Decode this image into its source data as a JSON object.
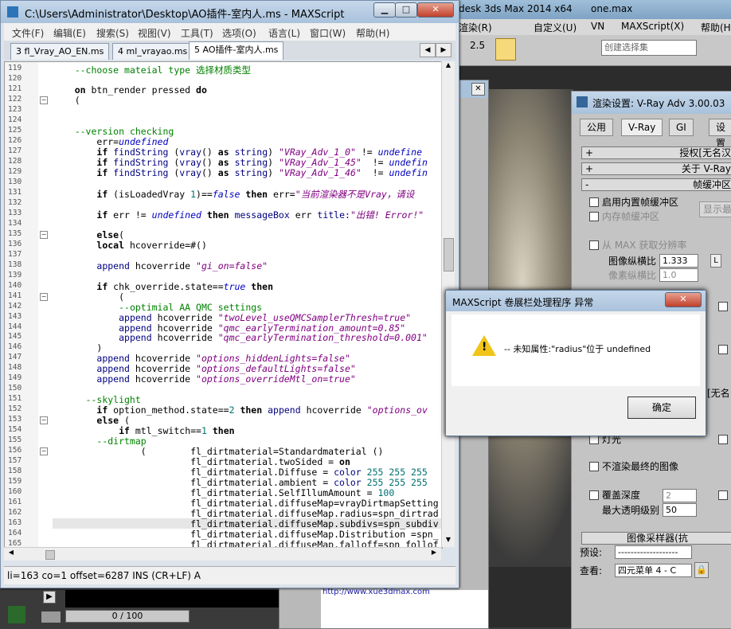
{
  "max": {
    "title": "desk 3ds Max  2014 x64",
    "file": "one.max",
    "menu": [
      "渲染(R)",
      "自定义(U)",
      "VN",
      "MAXScript(X)",
      "帮助(H"
    ],
    "toolbar": {
      "number": "2.5",
      "selection_set_placeholder": "创建选择集"
    }
  },
  "editor": {
    "title": "C:\\Users\\Administrator\\Desktop\\AO插件-室内人.ms - MAXScript",
    "menu": [
      "文件(F)",
      "编辑(E)",
      "搜索(S)",
      "视图(V)",
      "工具(T)",
      "选项(O)",
      "语言(L)",
      "窗口(W)",
      "帮助(H)"
    ],
    "tabs": [
      {
        "label": "3 fl_Vray_AO_EN.ms",
        "active": false
      },
      {
        "label": "4 ml_vrayao.ms",
        "active": false
      },
      {
        "label": "5 AO插件-室内人.ms",
        "active": true
      }
    ],
    "status": "li=163 co=1 offset=6287 INS (CR+LF) A",
    "lines": [
      {
        "n": "119",
        "html": "    <span class='cm'>--choose mateial type 选择材质类型</span>"
      },
      {
        "n": "120",
        "html": ""
      },
      {
        "n": "121",
        "html": "    <span class='kw'>on</span> btn_render pressed <span class='kw'>do</span>"
      },
      {
        "n": "122",
        "html": "    ("
      },
      {
        "n": "123",
        "html": ""
      },
      {
        "n": "124",
        "html": ""
      },
      {
        "n": "125",
        "html": "    <span class='cm'>--version checking</span>"
      },
      {
        "n": "126",
        "html": "        err=<span class='uv'>undefined</span>"
      },
      {
        "n": "127",
        "html": "        <span class='kw'>if</span> <span class='fn'>findString</span> (<span class='fn'>vray</span>() <span class='kw'>as</span> <span class='fn'>string</span>) <span class='st'>\"VRay_Adv_1_0\"</span> != <span class='uv'>undefine</span>"
      },
      {
        "n": "128",
        "html": "        <span class='kw'>if</span> <span class='fn'>findString</span> (<span class='fn'>vray</span>() <span class='kw'>as</span> <span class='fn'>string</span>) <span class='st'>\"VRay_Adv_1_45\"</span>  != <span class='uv'>undefin</span>"
      },
      {
        "n": "129",
        "html": "        <span class='kw'>if</span> <span class='fn'>findString</span> (<span class='fn'>vray</span>() <span class='kw'>as</span> <span class='fn'>string</span>) <span class='st'>\"VRay_Adv_1_46\"</span>  != <span class='uv'>undefin</span>"
      },
      {
        "n": "130",
        "html": ""
      },
      {
        "n": "131",
        "html": "        <span class='kw'>if</span> (isLoadedVray <span class='nm'>1</span>)==<span class='uv'>false</span> <span class='kw'>then</span> err=<span class='st'>\"当前渲染器不是Vray，请设</span>"
      },
      {
        "n": "132",
        "html": ""
      },
      {
        "n": "133",
        "html": "        <span class='kw'>if</span> err != <span class='uv'>undefined</span> <span class='kw'>then</span> <span class='fn'>messageBox</span> err <span class='fn'>title:</span><span class='st'>\"出错! Error!\"</span>"
      },
      {
        "n": "134",
        "html": ""
      },
      {
        "n": "135",
        "html": "        <span class='kw'>else</span>("
      },
      {
        "n": "136",
        "html": "        <span class='kw'>local</span> hcoverride=#()"
      },
      {
        "n": "137",
        "html": ""
      },
      {
        "n": "138",
        "html": "        <span class='fn'>append</span> hcoverride <span class='st'>\"gi_on=false\"</span>"
      },
      {
        "n": "139",
        "html": ""
      },
      {
        "n": "140",
        "html": "        <span class='kw'>if</span> chk_override.state==<span class='uv'>true</span> <span class='kw'>then</span>"
      },
      {
        "n": "141",
        "html": "            ("
      },
      {
        "n": "142",
        "html": "            <span class='cm'>--optimial AA QMC settings</span>"
      },
      {
        "n": "143",
        "html": "            <span class='fn'>append</span> hcoverride <span class='st'>\"twoLevel_useQMCSamplerThresh=true\"</span>"
      },
      {
        "n": "144",
        "html": "            <span class='fn'>append</span> hcoverride <span class='st'>\"qmc_earlyTermination_amount=0.85\"</span>"
      },
      {
        "n": "145",
        "html": "            <span class='fn'>append</span> hcoverride <span class='st'>\"qmc_earlyTermination_threshold=0.001\"</span>"
      },
      {
        "n": "146",
        "html": "        )"
      },
      {
        "n": "147",
        "html": "        <span class='fn'>append</span> hcoverride <span class='st'>\"options_hiddenLights=false\"</span>"
      },
      {
        "n": "148",
        "html": "        <span class='fn'>append</span> hcoverride <span class='st'>\"options_defaultLights=false\"</span>"
      },
      {
        "n": "149",
        "html": "        <span class='fn'>append</span> hcoverride <span class='st'>\"options_overrideMtl_on=true\"</span>"
      },
      {
        "n": "150",
        "html": ""
      },
      {
        "n": "151",
        "html": "      <span class='cm'>--skylight</span>"
      },
      {
        "n": "152",
        "html": "        <span class='kw'>if</span> option_method.state==<span class='nm'>2</span> <span class='kw'>then</span> <span class='fn'>append</span> hcoverride <span class='st'>\"options_ov</span>"
      },
      {
        "n": "153",
        "html": "        <span class='kw'>else</span> ("
      },
      {
        "n": "154",
        "html": "            <span class='kw'>if</span> mtl_switch==<span class='nm'>1</span> <span class='kw'>then</span>"
      },
      {
        "n": "155",
        "html": "        <span class='cm'>--dirtmap</span>"
      },
      {
        "n": "156",
        "html": "                (        fl_dirtmaterial=Standardmaterial ()"
      },
      {
        "n": "157",
        "html": "                         fl_dirtmaterial.twoSided = <span class='kw'>on</span>"
      },
      {
        "n": "158",
        "html": "                         fl_dirtmaterial.Diffuse = <span class='fn'>color</span> <span class='nm'>255 255 255</span>"
      },
      {
        "n": "159",
        "html": "                         fl_dirtmaterial.ambient = <span class='fn'>color</span> <span class='nm'>255 255 255</span>"
      },
      {
        "n": "160",
        "html": "                         fl_dirtmaterial.SelfIllumAmount = <span class='nm'>100</span>"
      },
      {
        "n": "161",
        "html": "                         fl_dirtmaterial.diffuseMap=vrayDirtmapSetting"
      },
      {
        "n": "162",
        "html": "                         fl_dirtmaterial.diffuseMap.radius=spn_dirtrad"
      },
      {
        "n": "163",
        "html": "                         fl_dirtmaterial.diffuseMap.subdivs=spn_subdiv"
      },
      {
        "n": "164",
        "html": "                         fl_dirtmaterial.diffuseMap.Distribution =spn_"
      },
      {
        "n": "165",
        "html": "                         fl_dirtmaterial.diffuseMap.falloff=spn_follof"
      }
    ]
  },
  "render_settings": {
    "title": "渲染设置: V-Ray Adv 3.00.03",
    "tabs": [
      "公用",
      "V-Ray",
      "GI",
      "设置"
    ],
    "rollouts": [
      "授权[无名汉",
      "关于 V-Ray",
      "帧缓冲区"
    ],
    "opts": {
      "builtin_fb": "启用内置帧缓冲区",
      "mem_fb": "内存帧缓冲区",
      "show_last": "显示最",
      "from_max": "从 MAX 获取分辨率",
      "aspect": "图像纵横比",
      "aspect_val": "1.333",
      "lock": "L",
      "pixel_aspect": "像素纵横比",
      "pixel_val": "1.0",
      "wuming": "[无名",
      "light": "灯光",
      "no_final": "不渲染最终的图像",
      "override_depth": "覆盖深度",
      "depth_val": "2",
      "max_transp": "最大透明级别",
      "transp_val": "50",
      "img_sampler": "图像采样器(抗",
      "preset_label": "预设:",
      "preset_val": "-------------------",
      "view_label": "查看:",
      "view_val": "四元菜单 4 - C"
    }
  },
  "error_dialog": {
    "title": "MAXScript 卷展栏处理程序 异常",
    "message": "-- 未知属性:\"radius\"位于 undefined",
    "ok": "确定"
  },
  "timeline": {
    "frame": "0 / 100"
  },
  "url": "http://www.xue3dmax.com"
}
